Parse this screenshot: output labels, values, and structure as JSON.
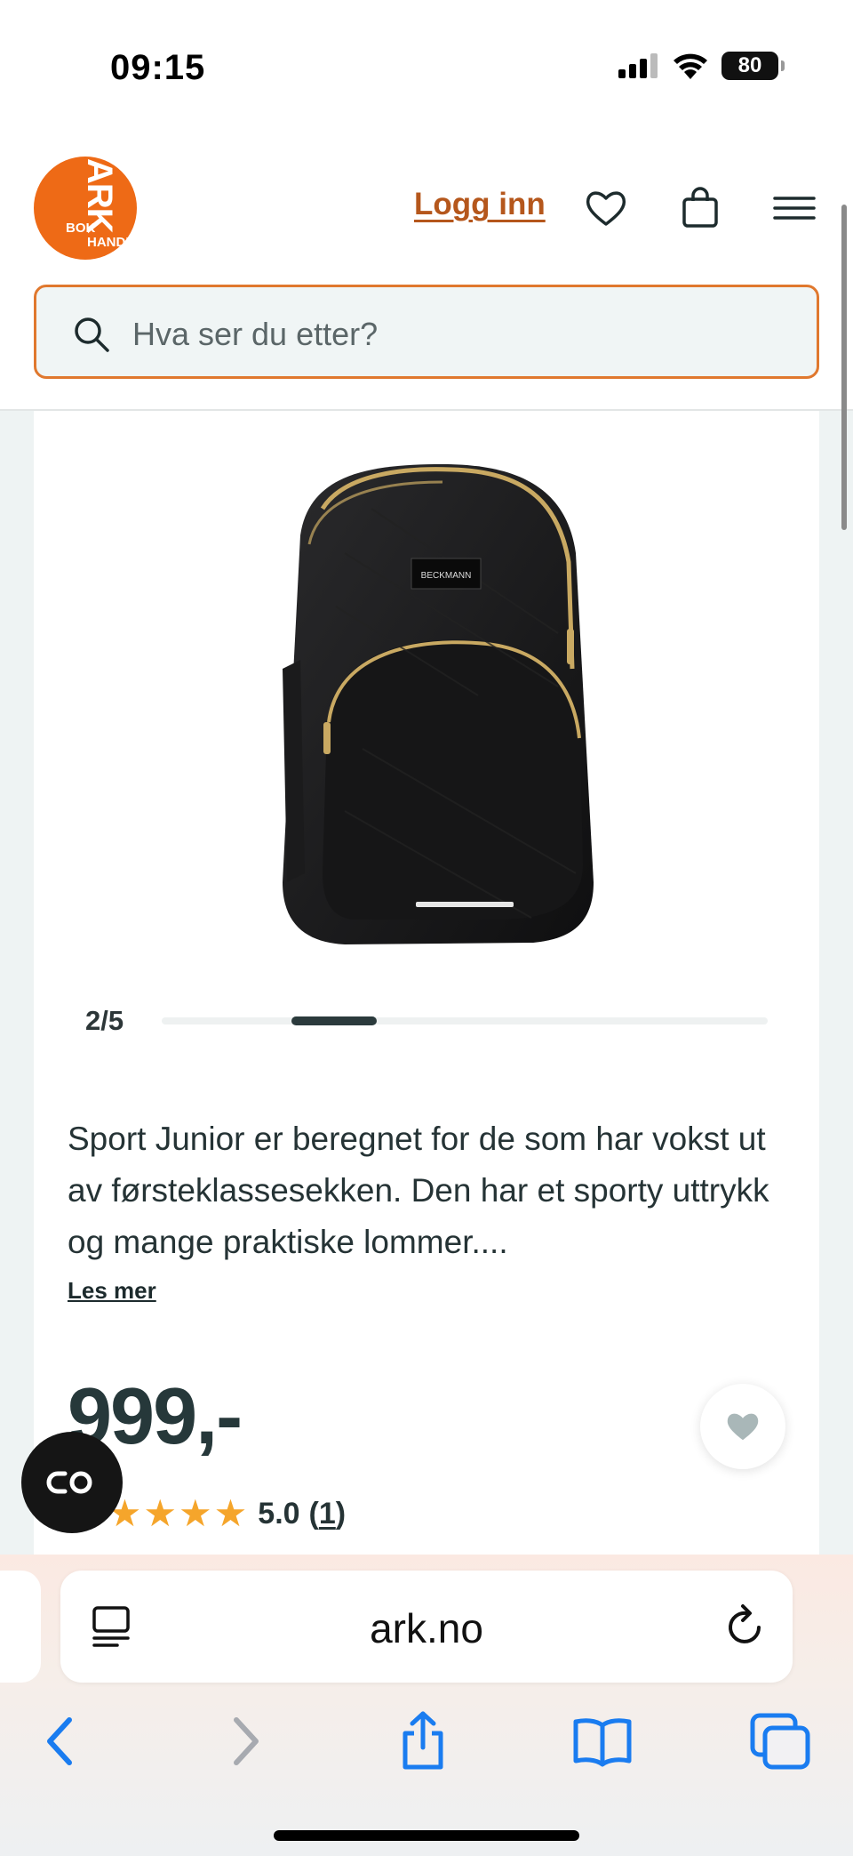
{
  "status_bar": {
    "time": "09:15",
    "battery": "80",
    "icons": [
      "signal-icon",
      "wifi-icon",
      "battery-icon"
    ]
  },
  "header": {
    "logo_text_main": "ARK",
    "logo_text_bok": "BOK",
    "logo_text_handel": "HANDEL",
    "login_label": "Logg inn",
    "icons": [
      "heart-icon",
      "bag-icon",
      "menu-icon"
    ],
    "brand_color": "#ee6a16",
    "search": {
      "placeholder": "Hva ser du etter?"
    }
  },
  "product": {
    "image_counter": "2/5",
    "image_progress": 0.4,
    "brand_on_bag": "BECKMANN",
    "description": "Sport Junior er beregnet for de som har vokst ut av førsteklassesekken. Den har et sporty uttrykk og mange praktiske lommer....",
    "read_more_label": "Les mer",
    "price": "999,-",
    "rating_stars": 5,
    "rating_score": "5.0",
    "review_count_open": "(",
    "review_count": "1",
    "review_count_close": ")"
  },
  "browser": {
    "url": "ark.no",
    "toolbar_icons": [
      "back-icon",
      "forward-icon",
      "share-icon",
      "bookmarks-icon",
      "tabs-icon"
    ],
    "accent": "#1a7cf0"
  }
}
